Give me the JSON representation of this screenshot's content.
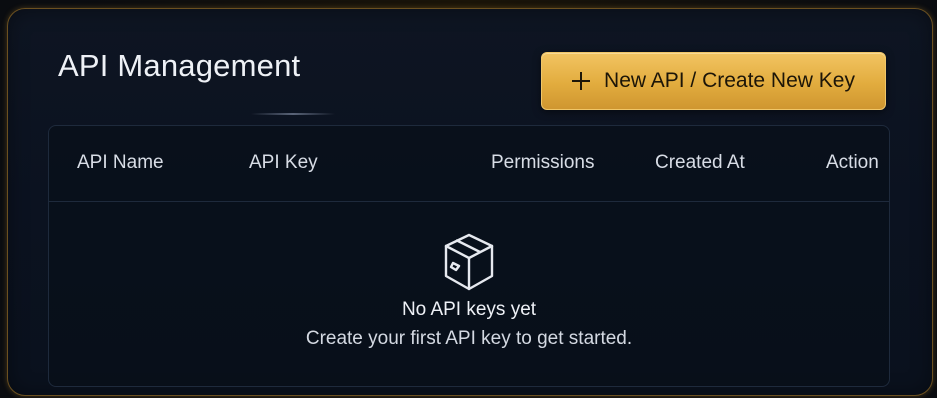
{
  "page": {
    "title": "API Management"
  },
  "toolbar": {
    "new_button_label": "New API / Create New Key",
    "new_button_icon": "plus-icon",
    "accent_color": "#e6b24a"
  },
  "table": {
    "columns": [
      "API Name",
      "API Key",
      "Permissions",
      "Created At",
      "Action"
    ],
    "rows": []
  },
  "empty_state": {
    "icon": "box-icon",
    "title": "No API keys yet",
    "subtitle": "Create your first API key to get started."
  }
}
